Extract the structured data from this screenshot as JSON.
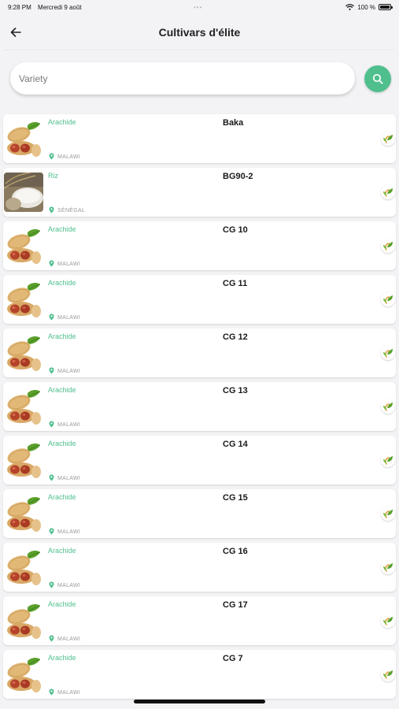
{
  "status_bar": {
    "time": "9:28 PM",
    "date": "Mercredi 9 août",
    "battery_text": "100 %",
    "battery_level": 1.0
  },
  "header": {
    "title": "Cultivars d'élite",
    "back_icon": "arrow-left-icon"
  },
  "search": {
    "placeholder": "Variety",
    "value": "",
    "button_icon": "search-icon"
  },
  "colors": {
    "accent": "#4fbf8e",
    "background": "#f3f3f5",
    "crop_text": "#4fbf8e",
    "location_text": "#9a9a9a"
  },
  "items": [
    {
      "crop": "Arachide",
      "location": "MALAWI",
      "variety": "Baka",
      "image": "peanut-image"
    },
    {
      "crop": "Riz",
      "location": "SÉNÉGAL",
      "variety": "BG90-2",
      "image": "rice-image"
    },
    {
      "crop": "Arachide",
      "location": "MALAWI",
      "variety": "CG 10",
      "image": "peanut-image"
    },
    {
      "crop": "Arachide",
      "location": "MALAWI",
      "variety": "CG 11",
      "image": "peanut-image"
    },
    {
      "crop": "Arachide",
      "location": "MALAWI",
      "variety": "CG 12",
      "image": "peanut-image"
    },
    {
      "crop": "Arachide",
      "location": "MALAWI",
      "variety": "CG 13",
      "image": "peanut-image"
    },
    {
      "crop": "Arachide",
      "location": "MALAWI",
      "variety": "CG 14",
      "image": "peanut-image"
    },
    {
      "crop": "Arachide",
      "location": "MALAWI",
      "variety": "CG 15",
      "image": "peanut-image"
    },
    {
      "crop": "Arachide",
      "location": "MALAWI",
      "variety": "CG 16",
      "image": "peanut-image"
    },
    {
      "crop": "Arachide",
      "location": "MALAWI",
      "variety": "CG 17",
      "image": "peanut-image"
    },
    {
      "crop": "Arachide",
      "location": "MALAWI",
      "variety": "CG 7",
      "image": "peanut-image"
    }
  ]
}
